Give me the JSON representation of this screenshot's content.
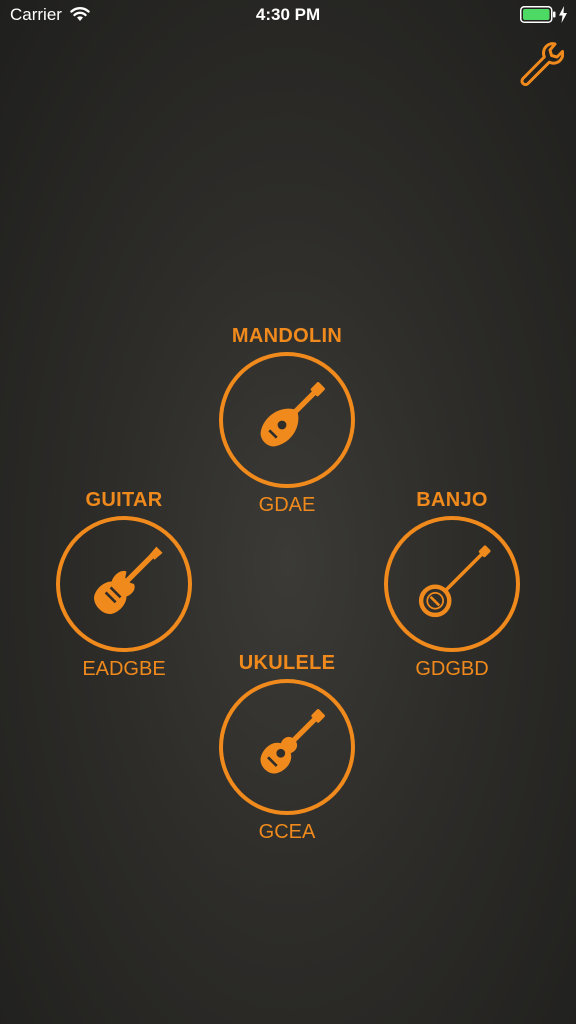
{
  "status_bar": {
    "carrier": "Carrier",
    "time": "4:30 PM",
    "battery_color": "#4cd964"
  },
  "accent_color": "#f08a1c",
  "settings": {
    "icon": "wrench-icon"
  },
  "instruments": {
    "mandolin": {
      "name": "MANDOLIN",
      "tuning": "GDAE",
      "icon": "mandolin-icon"
    },
    "guitar": {
      "name": "GUITAR",
      "tuning": "EADGBE",
      "icon": "electric-guitar-icon"
    },
    "banjo": {
      "name": "BANJO",
      "tuning": "GDGBD",
      "icon": "banjo-icon"
    },
    "ukulele": {
      "name": "UKULELE",
      "tuning": "GCEA",
      "icon": "ukulele-icon"
    }
  }
}
